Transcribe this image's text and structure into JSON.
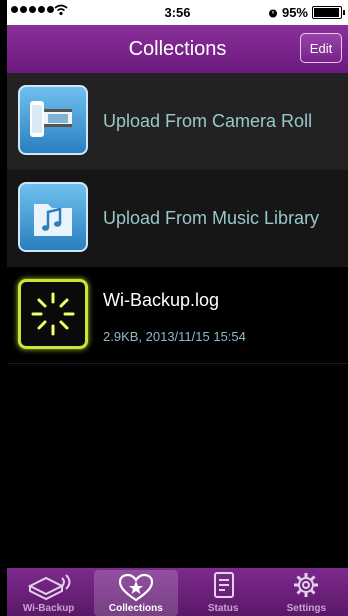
{
  "status_bar": {
    "time": "3:56",
    "battery": "95%"
  },
  "navbar": {
    "title": "Collections",
    "edit_label": "Edit"
  },
  "list": {
    "items": [
      {
        "label": "Upload From Camera Roll",
        "icon": "film-strip-icon"
      },
      {
        "label": "Upload From Music Library",
        "icon": "music-note-icon"
      }
    ],
    "file": {
      "name": "Wi-Backup.log",
      "meta": "2.9KB, 2013/11/15 15:54",
      "icon": "log-sun-icon"
    }
  },
  "tabbar": {
    "tabs": [
      {
        "label": "Wi-Backup",
        "icon": "wifi-box-icon"
      },
      {
        "label": "Collections",
        "icon": "heart-star-icon"
      },
      {
        "label": "Status",
        "icon": "document-icon"
      },
      {
        "label": "Settings",
        "icon": "gear-icon"
      }
    ],
    "active_index": 1
  },
  "colors": {
    "accent": "#7a2a8c",
    "log_icon": "#c9e43a"
  }
}
